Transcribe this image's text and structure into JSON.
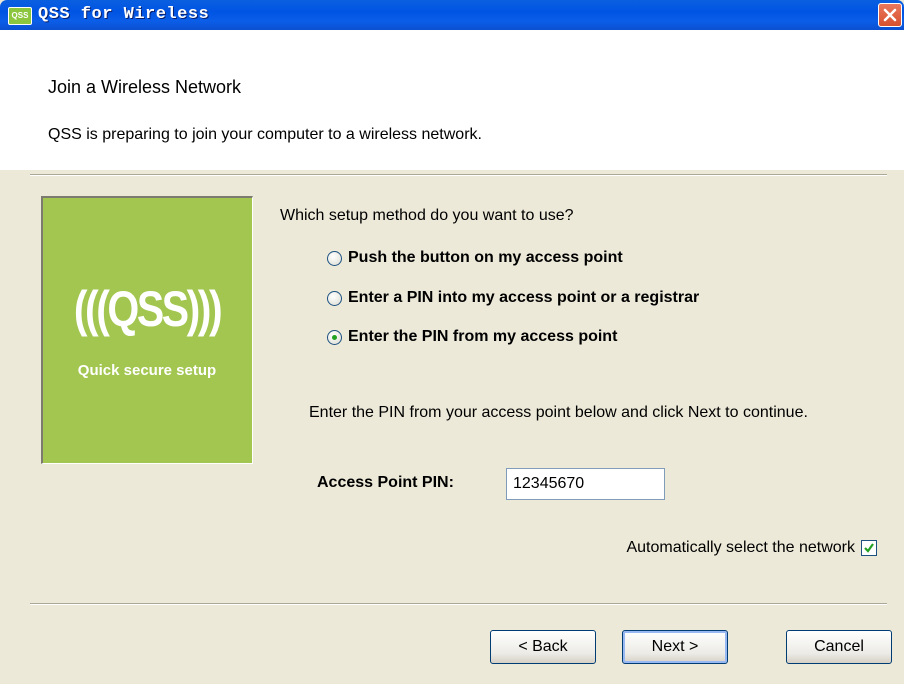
{
  "window": {
    "icon_text": "QSS",
    "title": "QSS for Wireless"
  },
  "header": {
    "title": "Join a Wireless Network",
    "subtitle": "QSS is preparing to join your computer to a wireless network."
  },
  "logo": {
    "mark": "(((QSS)))",
    "caption": "Quick secure setup"
  },
  "setup": {
    "question": "Which setup method do you want to use?",
    "options": [
      {
        "label": "Push the button on my access point",
        "checked": false
      },
      {
        "label": "Enter a PIN into my access point or a registrar",
        "checked": false
      },
      {
        "label": "Enter the PIN from my access point",
        "checked": true
      }
    ],
    "hint": "Enter the PIN from your access point below and click Next to continue.",
    "pin_label": "Access Point PIN:",
    "pin_value": "12345670",
    "auto_select_label": "Automatically select the network",
    "auto_select_checked": true
  },
  "buttons": {
    "back": "< Back",
    "next": "Next >",
    "cancel": "Cancel"
  },
  "colors": {
    "title_bar": "#0054e3",
    "logo_green": "#a2c64f",
    "window_bg": "#ece9d8"
  }
}
